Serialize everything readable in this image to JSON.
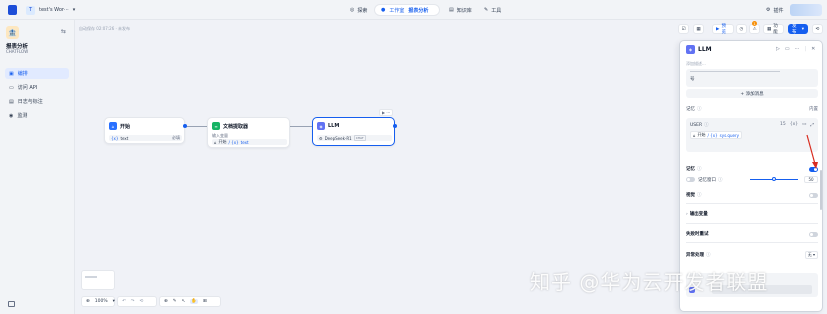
{
  "topbar": {
    "workspace_initial": "T",
    "workspace_name": "test's Wor···",
    "nav": {
      "explore": "探索",
      "studio": "工作室",
      "current_app": "报表分析",
      "knowledge": "知识库",
      "tools": "工具"
    },
    "plugin": "插件"
  },
  "sidebar": {
    "app_name": "报表分析",
    "app_type": "CHATFLOW",
    "items": [
      {
        "label": "编排",
        "icon": "orchestrate-icon"
      },
      {
        "label": "访问 API",
        "icon": "api-icon"
      },
      {
        "label": "日志与标注",
        "icon": "log-icon"
      },
      {
        "label": "监测",
        "icon": "monitor-icon"
      }
    ]
  },
  "canvas": {
    "autosave": "自动保存 02:07:26 · 未发布",
    "zoom": "100%",
    "nodes": {
      "start": {
        "title": "开始",
        "field": "text",
        "required": "必填"
      },
      "doc": {
        "title": "文档提取器",
        "subtitle": "输入变量",
        "source": "开始",
        "var": "text"
      },
      "llm": {
        "title": "LLM",
        "model": "DeepSeek-R1",
        "mode": "CHAT"
      }
    }
  },
  "right_toolbar": {
    "run": "预览",
    "features": "功能",
    "publish": "发布",
    "badge": "1"
  },
  "panel": {
    "title": "LLM",
    "desc_placeholder": "添加描述...",
    "prompt_tail": "号",
    "add_message": "+ 添加消息",
    "memory_label": "记忆",
    "memory_value": "内置",
    "user_label": "USER",
    "user_count": "15",
    "user_source": "开始",
    "user_var": "sys.query",
    "memory_toggle_label": "记忆",
    "memory_window_label": "记忆窗口",
    "memory_window_value": "50",
    "vision_label": "视觉",
    "output_vars": "输出变量",
    "retry_label": "失败时重试",
    "error_label": "异常处理",
    "error_value": "无"
  },
  "watermark": "知乎 @华为云开发者联盟",
  "colors": {
    "accent": "#155eef",
    "arrow": "#d92d20"
  }
}
